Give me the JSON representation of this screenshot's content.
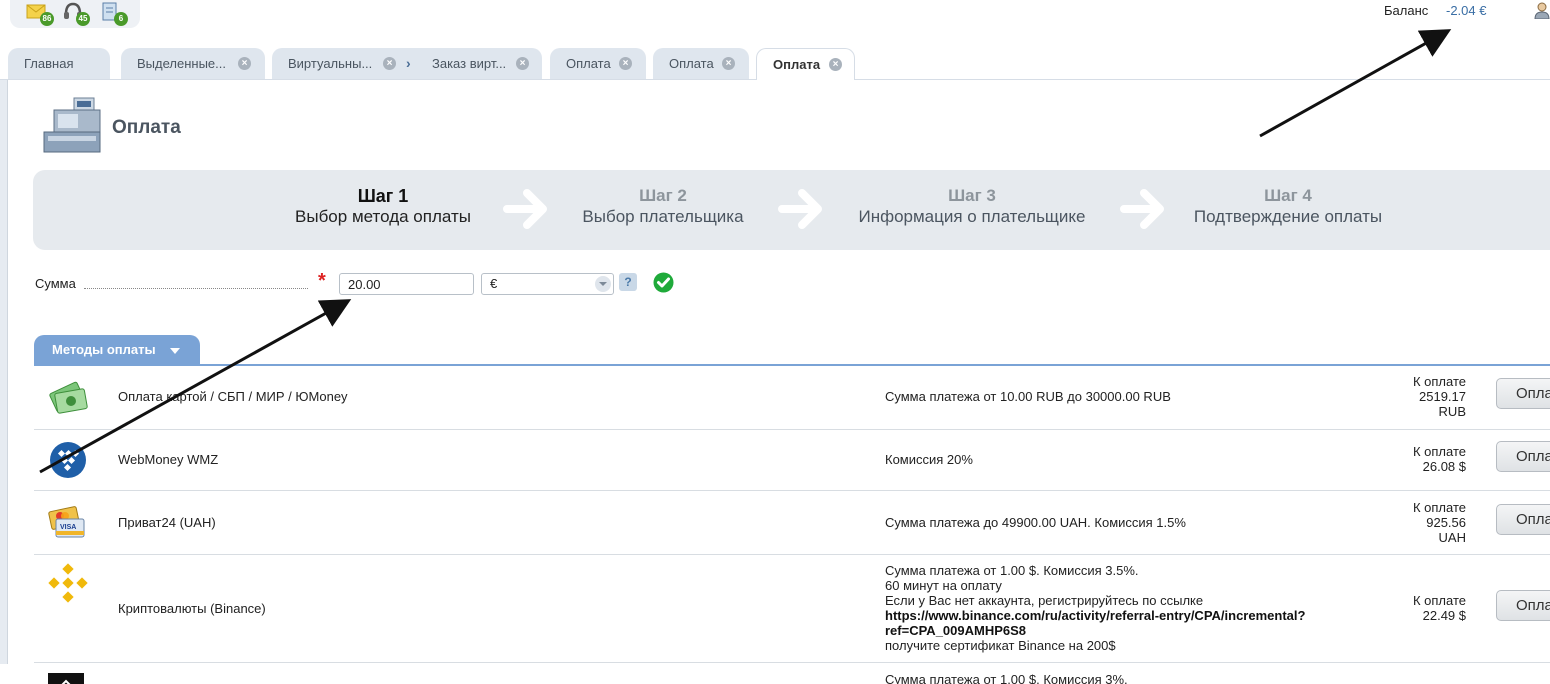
{
  "toolbar": {
    "icons": [
      {
        "name": "mail-icon",
        "badge": "86"
      },
      {
        "name": "support-icon",
        "badge": "45"
      },
      {
        "name": "document-icon",
        "badge": "6"
      }
    ]
  },
  "header": {
    "balance_label": "Баланс",
    "balance_value": "-2.04 €"
  },
  "tabs": [
    {
      "label": "Главная"
    },
    {
      "label": "Выделенные..."
    },
    {
      "label": "Виртуальны..."
    },
    {
      "label": "Заказ вирт..."
    },
    {
      "label": "Оплата"
    },
    {
      "label": "Оплата"
    },
    {
      "label": "Оплата"
    }
  ],
  "page": {
    "title": "Оплата"
  },
  "steps": [
    {
      "num": "Шаг 1",
      "desc": "Выбор метода оплаты"
    },
    {
      "num": "Шаг 2",
      "desc": "Выбор плательщика"
    },
    {
      "num": "Шаг 3",
      "desc": "Информация о плательщике"
    },
    {
      "num": "Шаг 4",
      "desc": "Подтверждение оплаты"
    }
  ],
  "amount": {
    "label": "Сумма",
    "required_mark": "*",
    "value": "20.00",
    "currency": "€",
    "help": "?"
  },
  "methods": {
    "tab_label": "Методы оплаты",
    "pay_label": "Опла",
    "rows": [
      {
        "name": "Оплата картой / СБП / МИР / ЮMoney",
        "desc_lines": [
          "Сумма платежа от 10.00 RUB до 30000.00 RUB"
        ],
        "pay_lines": [
          "К оплате",
          "2519.17",
          "RUB"
        ]
      },
      {
        "name": "WebMoney WMZ",
        "desc_lines": [
          "Комиссия 20%"
        ],
        "pay_lines": [
          "К оплате",
          "26.08 $"
        ]
      },
      {
        "name": "Приват24 (UAH)",
        "desc_lines": [
          "Сумма платежа до 49900.00 UAH. Комиссия 1.5%"
        ],
        "pay_lines": [
          "К оплате",
          "925.56",
          "UAH"
        ]
      },
      {
        "name": "Криптовалюты (Binance)",
        "desc_lines": [
          "Сумма платежа от 1.00 $. Комиссия 3.5%.",
          "60 минут на оплату",
          "Если у Вас нет аккаунта, регистрируйтесь по ссылке"
        ],
        "link_lines": [
          "https://www.binance.com/ru/activity/referral-entry/CPA/incremental?",
          "ref=CPA_009AMHP6S8"
        ],
        "after_link": "получите сертификат Binance на 200$",
        "pay_lines": [
          "К оплате",
          "22.49 $"
        ]
      },
      {
        "name": "",
        "desc_lines": [
          "Сумма платежа от 1.00 $. Комиссия 3%."
        ],
        "pay_lines": []
      }
    ]
  }
}
